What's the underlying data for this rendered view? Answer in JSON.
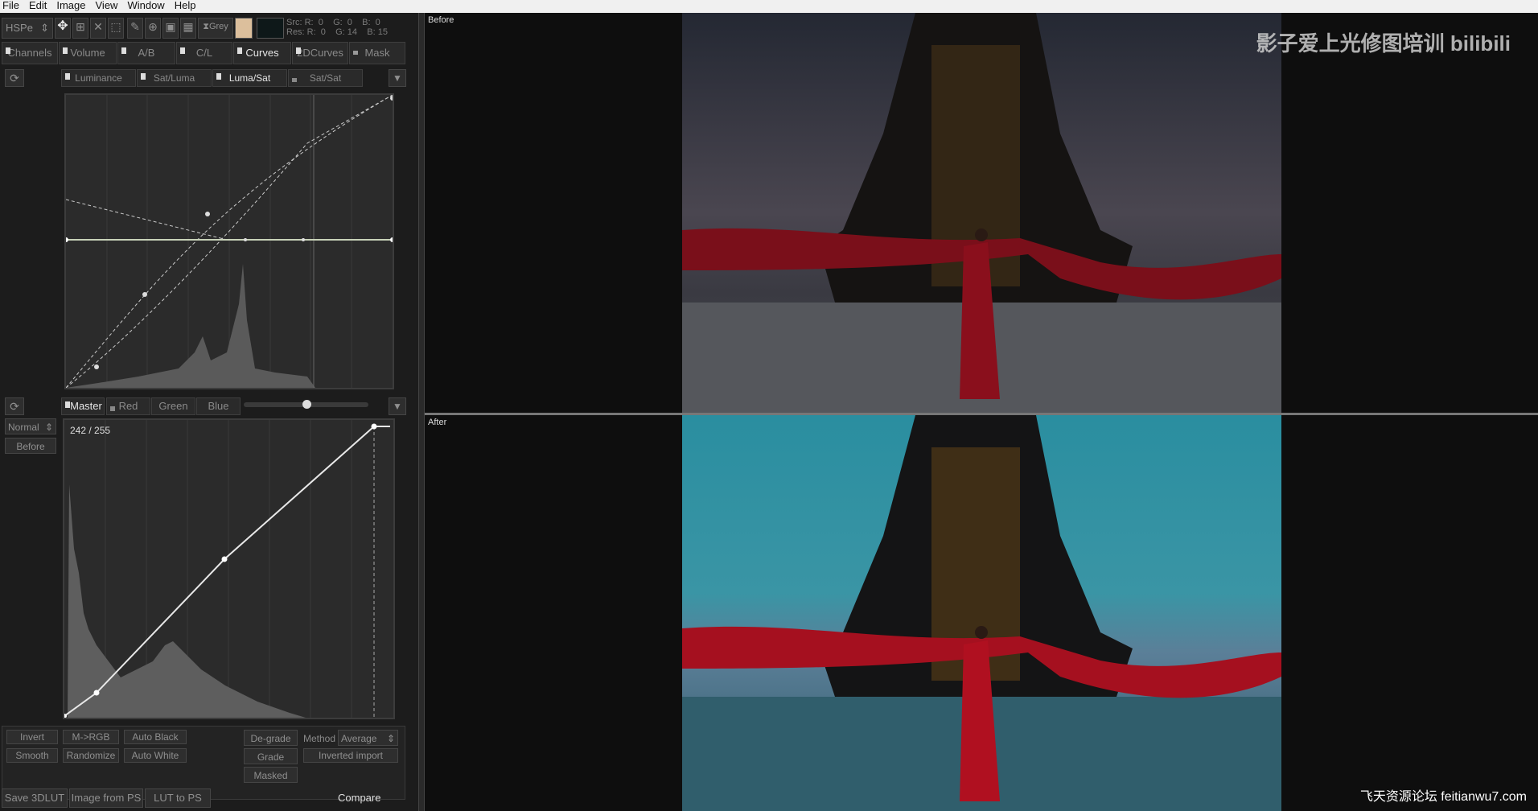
{
  "menu": [
    "File",
    "Edit",
    "Image",
    "View",
    "Window",
    "Help"
  ],
  "toolbar": {
    "mode": "HSPe",
    "grey_label": "Grey",
    "swatch_color": "#dcbf9c",
    "swatch2_color": "#0e1819",
    "src": "Src: R:  0    G:  0    B:  0",
    "res": "Res: R:  0    G: 14    B: 15"
  },
  "tabs": [
    "Channels",
    "Volume",
    "A/B",
    "C/L",
    "Curves",
    "2DCurves",
    "Mask"
  ],
  "subtabs": [
    "Luminance",
    "Sat/Luma",
    "Luma/Sat",
    "Sat/Sat"
  ],
  "channels": [
    "Master",
    "Red",
    "Green",
    "Blue"
  ],
  "blend_mode": "Normal",
  "before_button": "Before",
  "curve_readout": "242 / 255",
  "slider_value": 0.5,
  "buttons": {
    "invert": "Invert",
    "m2rgb": "M->RGB",
    "auto_black": "Auto Black",
    "smooth": "Smooth",
    "randomize": "Randomize",
    "auto_white": "Auto White",
    "degrade": "De-grade",
    "grade": "Grade",
    "masked": "Masked",
    "method_label": "Method",
    "method_value": "Average",
    "inverted_import": "Inverted import"
  },
  "bottom": {
    "save": "Save 3DLUT",
    "image_from_ps": "Image from PS",
    "lut_to_ps": "LUT to PS",
    "compare": "Compare"
  },
  "panes": {
    "before": "Before",
    "after": "After"
  },
  "watermark": "影子爱上光修图培训 bilibili",
  "watermark2": "飞天资源论坛 feitianwu7.com"
}
